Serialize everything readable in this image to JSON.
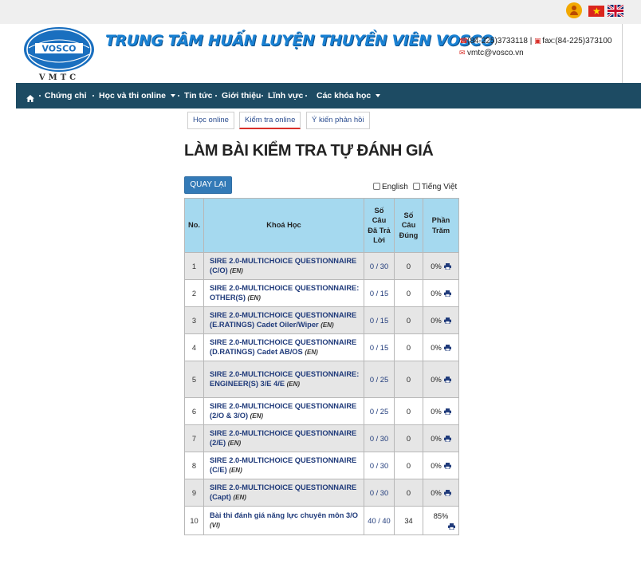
{
  "topbar": {
    "user_icon": "user-circle-icon",
    "flags": [
      "flag-vietnam-icon",
      "flag-uk-icon"
    ]
  },
  "header": {
    "logo_text": "VOSCO",
    "logo_subtext": "VMTC",
    "title": "TRUNG TÂM HUẤN LUYỆN THUYỀN VIÊN VOSCO",
    "phone": "(84-225)3733118",
    "separator": "|",
    "fax": "fax:(84-225)373100",
    "email": "vmtc@vosco.vn"
  },
  "nav": {
    "home_icon": "home-icon",
    "items": [
      {
        "label": "Chứng chỉ",
        "dropdown": false
      },
      {
        "label": "Học và thi online",
        "dropdown": true
      },
      {
        "label": "Tin tức",
        "dropdown": false
      },
      {
        "label": "Giới thiệu",
        "dropdown": false
      },
      {
        "label": "Lĩnh vực",
        "dropdown": false
      },
      {
        "label": "Các khóa học",
        "dropdown": true
      }
    ]
  },
  "tabs": [
    {
      "label": "Học online",
      "active": false
    },
    {
      "label": "Kiểm tra online",
      "active": true
    },
    {
      "label": "Ý kiến phản hồi",
      "active": false
    }
  ],
  "page": {
    "title": "LÀM BÀI KIỂM TRA TỰ ĐÁNH GIÁ",
    "back_button": "QUAY LẠI",
    "lang_english": "English",
    "lang_vietnamese": "Tiếng Việt"
  },
  "table": {
    "headers": {
      "no": "No.",
      "course": "Khoá Học",
      "answered": [
        "Số",
        "Câu",
        "Đã Trả",
        "Lời"
      ],
      "correct": [
        "Số",
        "Câu",
        "Đúng"
      ],
      "percent": [
        "Phần",
        "Trăm"
      ]
    },
    "rows": [
      {
        "no": "1",
        "course": "SIRE 2.0-MULTICHOICE QUESTIONNAIRE (C/O)",
        "lang": "(EN)",
        "answered": "0 / 30",
        "correct": "0",
        "percent": "0%"
      },
      {
        "no": "2",
        "course": "SIRE 2.0-MULTICHOICE QUESTIONNAIRE: OTHER(S)",
        "lang": "(EN)",
        "answered": "0 / 15",
        "correct": "0",
        "percent": "0%"
      },
      {
        "no": "3",
        "course": "SIRE 2.0-MULTICHOICE QUESTIONNAIRE (E.RATINGS) Cadet Oiler/Wiper",
        "lang": "(EN)",
        "answered": "0 / 15",
        "correct": "0",
        "percent": "0%"
      },
      {
        "no": "4",
        "course": "SIRE 2.0-MULTICHOICE QUESTIONNAIRE (D.RATINGS) Cadet AB/OS",
        "lang": "(EN)",
        "answered": "0 / 15",
        "correct": "0",
        "percent": "0%"
      },
      {
        "no": "5",
        "course": "SIRE 2.0-MULTICHOICE QUESTIONNAIRE: ENGINEER(S) 3/E 4/E",
        "lang": "(EN)",
        "answered": "0 / 25",
        "correct": "0",
        "percent": "0%"
      },
      {
        "no": "6",
        "course": "SIRE 2.0-MULTICHOICE QUESTIONNAIRE (2/O & 3/O)",
        "lang": "(EN)",
        "answered": "0 / 25",
        "correct": "0",
        "percent": "0%"
      },
      {
        "no": "7",
        "course": "SIRE 2.0-MULTICHOICE QUESTIONNAIRE (2/E)",
        "lang": "(EN)",
        "answered": "0 / 30",
        "correct": "0",
        "percent": "0%"
      },
      {
        "no": "8",
        "course": "SIRE 2.0-MULTICHOICE QUESTIONNAIRE (C/E)",
        "lang": "(EN)",
        "answered": "0 / 30",
        "correct": "0",
        "percent": "0%"
      },
      {
        "no": "9",
        "course": "SIRE 2.0-MULTICHOICE QUESTIONNAIRE (Capt)",
        "lang": "(EN)",
        "answered": "0 / 30",
        "correct": "0",
        "percent": "0%"
      },
      {
        "no": "10",
        "course": "Bài thi đánh giá năng lực chuyên môn 3/O",
        "lang": "(VI)",
        "answered": "40 / 40",
        "correct": "34",
        "percent": "85%"
      }
    ],
    "print_icon": "print-icon"
  },
  "colors": {
    "nav_bg": "#1d4b63",
    "header_th_bg": "#a5d9ef",
    "button_bg": "#337ab7",
    "title_blue": "#1a82d4",
    "link_blue": "#1f3a7a"
  }
}
